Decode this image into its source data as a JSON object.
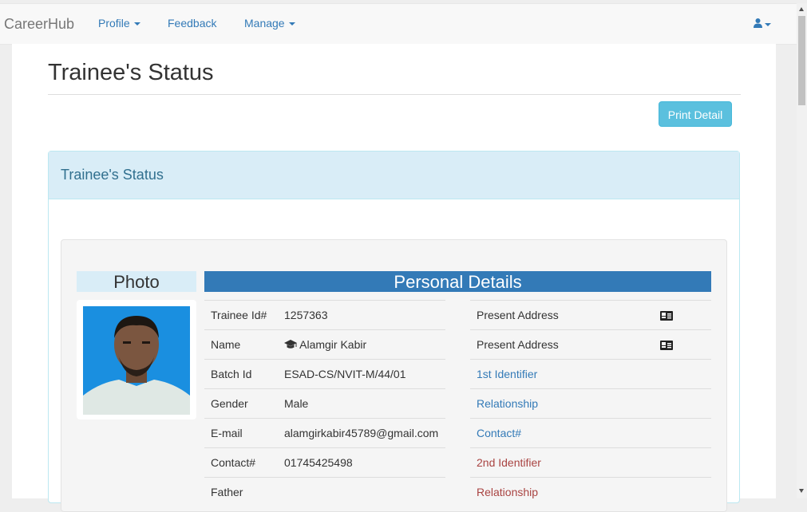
{
  "navbar": {
    "brand": "CareerHub",
    "items": [
      {
        "label": "Profile"
      },
      {
        "label": "Feedback"
      },
      {
        "label": "Manage"
      }
    ]
  },
  "page": {
    "title": "Trainee's Status",
    "print_button": "Print Detail"
  },
  "panel": {
    "title": "Trainee's Status",
    "photo_heading": "Photo",
    "details_heading": "Personal Details"
  },
  "personal": [
    {
      "label": "Trainee Id#",
      "value": "1257363"
    },
    {
      "label": "Name",
      "value": "Alamgir Kabir"
    },
    {
      "label": "Batch Id",
      "value": "ESAD-CS/NVIT-M/44/01"
    },
    {
      "label": "Gender",
      "value": "Male"
    },
    {
      "label": "E-mail",
      "value": "alamgirkabir45789@gmail.com"
    },
    {
      "label": "Contact#",
      "value": "01745425498"
    },
    {
      "label": "Father",
      "value": ""
    }
  ],
  "right_column": [
    {
      "label": "Present Address",
      "icon": "address-card-icon"
    },
    {
      "label": "Present Address",
      "icon": "address-card-icon"
    },
    {
      "label": "1st Identifier"
    },
    {
      "label": "Relationship"
    },
    {
      "label": "Contact#"
    },
    {
      "label": "2nd Identifier"
    },
    {
      "label": "Relationship"
    }
  ],
  "colors": {
    "accent": "#337ab7",
    "info": "#5bc0de",
    "panel_heading": "#d9edf7",
    "danger_text": "#a94442"
  }
}
